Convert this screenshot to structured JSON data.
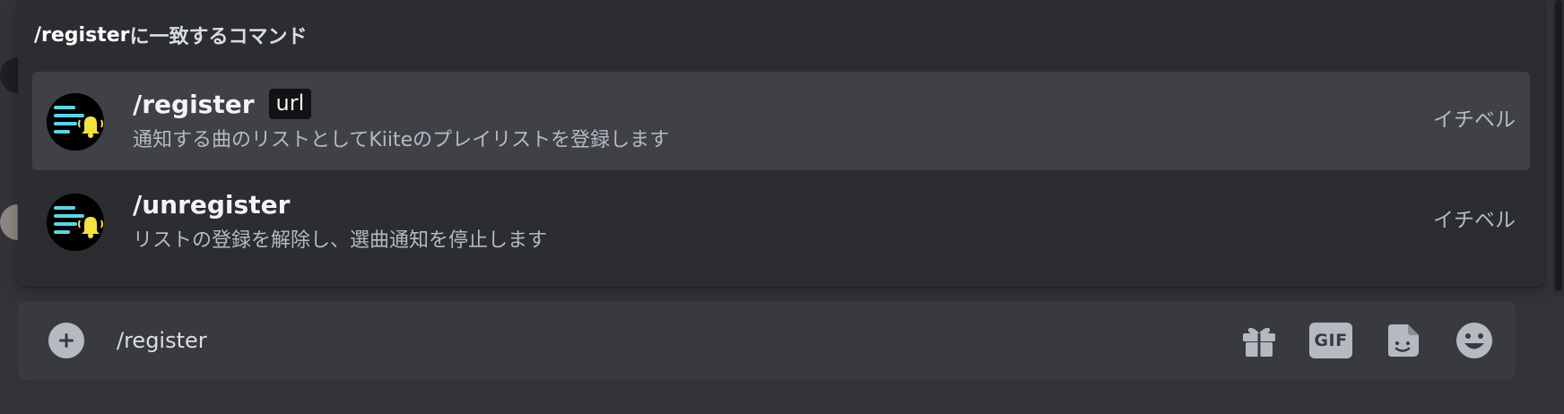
{
  "popup": {
    "header_query": "/register",
    "header_suffix": "に一致するコマンド",
    "commands": [
      {
        "name": "/register",
        "option": "url",
        "description": "通知する曲のリストとしてKiiteのプレイリストを登録します",
        "app": "イチベル",
        "selected": true,
        "icon": "bot-playlist-bell-icon"
      },
      {
        "name": "/unregister",
        "option": "",
        "description": "リストの登録を解除し、選曲通知を停止します",
        "app": "イチベル",
        "selected": false,
        "icon": "bot-playlist-bell-icon"
      }
    ]
  },
  "composer": {
    "value": "/register",
    "gif_label": "GIF",
    "icons": [
      "add-circle-icon",
      "gift-icon",
      "gif-icon",
      "sticker-icon",
      "emoji-icon"
    ]
  },
  "colors": {
    "background": "#313338",
    "popup": "#2b2d31",
    "selected_row": "#3f4147",
    "composer": "#383a40",
    "bot_lines": "#5fd3e4",
    "bot_bell": "#f3e23c"
  }
}
